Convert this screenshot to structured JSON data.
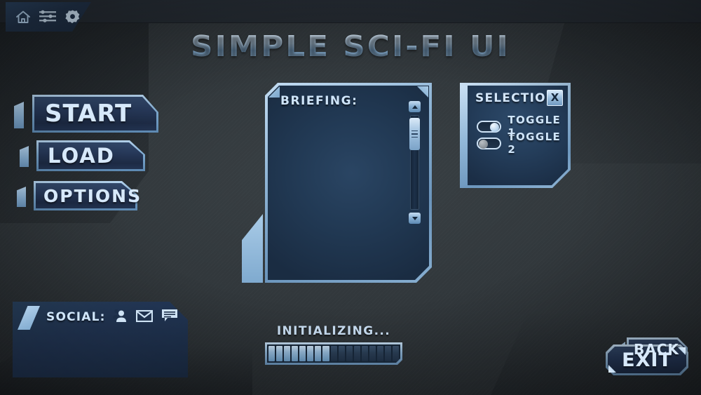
{
  "app": {
    "title": "SIMPLE SCI-FI UI"
  },
  "colors": {
    "accent_light": "#b7d4ee",
    "accent_mid": "#7ba7cd",
    "panel_dark": "#1c2e48",
    "text": "#cfe5fa",
    "background": "#31373b"
  },
  "topbar": {
    "icons": [
      {
        "name": "home-icon",
        "label": "Home"
      },
      {
        "name": "sliders-icon",
        "label": "Settings List"
      },
      {
        "name": "gear-icon",
        "label": "Options"
      }
    ]
  },
  "menu": {
    "buttons": [
      {
        "label": "START",
        "name": "start-button"
      },
      {
        "label": "LOAD",
        "name": "load-button"
      },
      {
        "label": "OPTIONS",
        "name": "options-button"
      }
    ]
  },
  "briefing": {
    "title": "BRIEFING:",
    "body": "",
    "back_label": "BACK",
    "scrollbar": {
      "up_arrow": "▲",
      "down_arrow": "▼",
      "thumb_position_pct": 14
    }
  },
  "selection": {
    "title": "SELECTION",
    "close_label": "X",
    "toggles": [
      {
        "label": "TOGGLE 1",
        "state": "on"
      },
      {
        "label": "TOGGLE 2",
        "state": "off"
      }
    ]
  },
  "social": {
    "title": "SOCIAL:",
    "icons": [
      {
        "name": "friends-icon",
        "label": "Friends"
      },
      {
        "name": "mail-icon",
        "label": "Mail"
      },
      {
        "name": "chat-icon",
        "label": "Chat"
      }
    ]
  },
  "progress": {
    "label": "INITIALIZING...",
    "segments_total": 17,
    "segments_filled": 8,
    "percent": 47
  },
  "exit": {
    "label": "EXIT"
  }
}
